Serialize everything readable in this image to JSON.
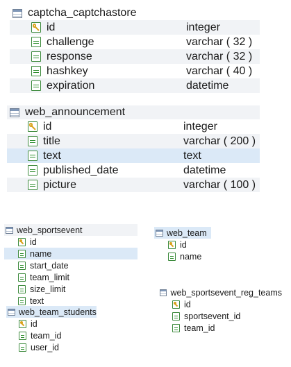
{
  "tables": [
    {
      "name": "captcha_captchastore",
      "columns": [
        {
          "name": "id",
          "type": "integer",
          "key": true
        },
        {
          "name": "challenge",
          "type": "varchar ( 32 )",
          "key": false
        },
        {
          "name": "response",
          "type": "varchar ( 32 )",
          "key": false
        },
        {
          "name": "hashkey",
          "type": "varchar ( 40 )",
          "key": false
        },
        {
          "name": "expiration",
          "type": "datetime",
          "key": false
        }
      ]
    },
    {
      "name": "web_announcement",
      "columns": [
        {
          "name": "id",
          "type": "integer",
          "key": true
        },
        {
          "name": "title",
          "type": "varchar ( 200 )",
          "key": false
        },
        {
          "name": "text",
          "type": "text",
          "key": false,
          "selected": true
        },
        {
          "name": "published_date",
          "type": "datetime",
          "key": false
        },
        {
          "name": "picture",
          "type": "varchar ( 100 )",
          "key": false
        }
      ]
    },
    {
      "name": "web_sportsevent",
      "columns": [
        {
          "name": "id",
          "key": true
        },
        {
          "name": "name",
          "key": false,
          "selected": true
        },
        {
          "name": "start_date",
          "key": false
        },
        {
          "name": "team_limit",
          "key": false
        },
        {
          "name": "size_limit",
          "key": false
        },
        {
          "name": "text",
          "key": false
        }
      ]
    },
    {
      "name": "web_team_students",
      "columns": [
        {
          "name": "id",
          "key": true
        },
        {
          "name": "team_id",
          "key": false
        },
        {
          "name": "user_id",
          "key": false
        }
      ]
    },
    {
      "name": "web_team",
      "columns": [
        {
          "name": "id",
          "key": true
        },
        {
          "name": "name",
          "key": false
        }
      ]
    },
    {
      "name": "web_sportsevent_reg_teams",
      "columns": [
        {
          "name": "id",
          "key": true
        },
        {
          "name": "sportsevent_id",
          "key": false
        },
        {
          "name": "team_id",
          "key": false
        }
      ]
    }
  ]
}
